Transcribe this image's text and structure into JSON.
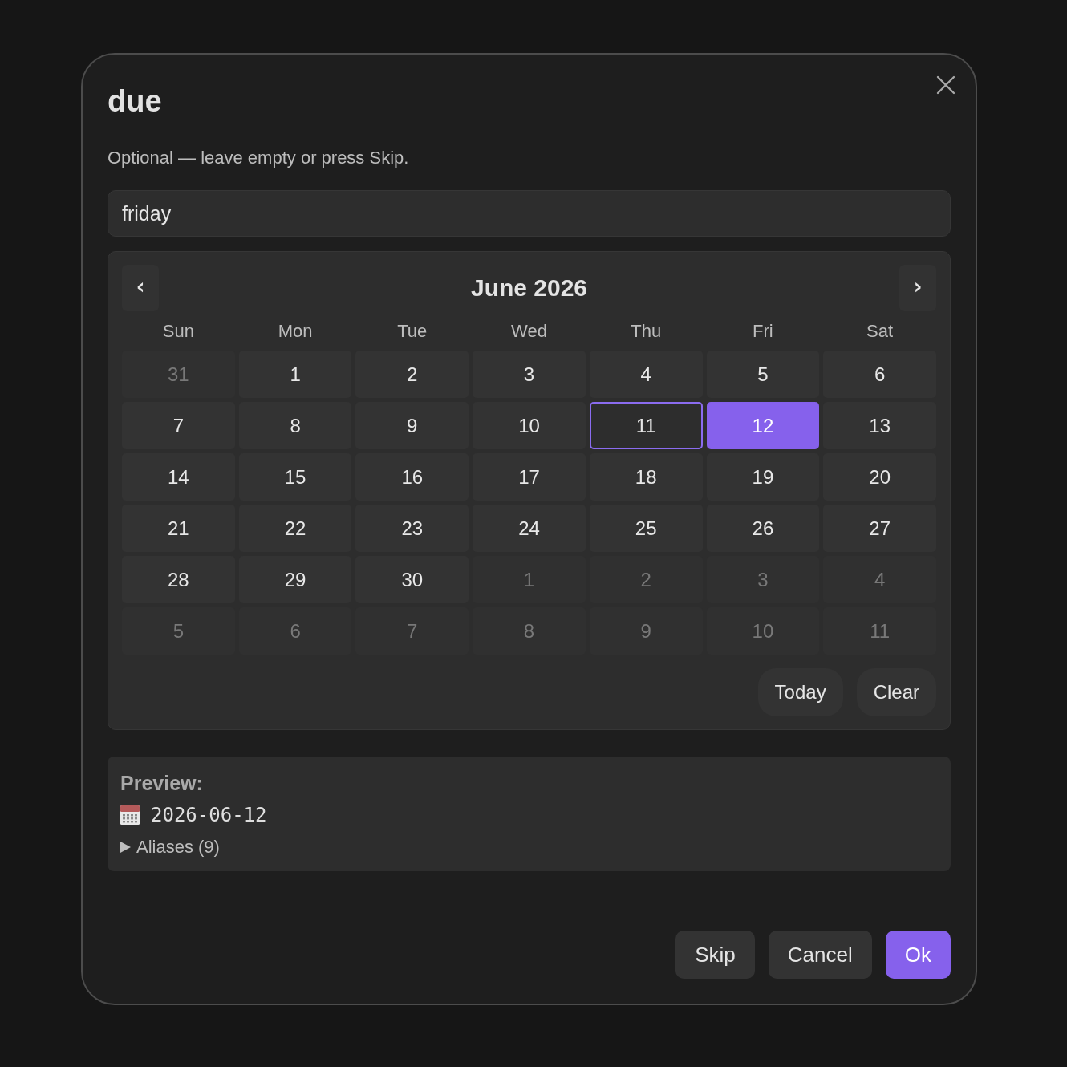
{
  "dialog": {
    "title": "due",
    "description": "Optional — leave empty or press Skip."
  },
  "input": {
    "value": "friday"
  },
  "calendar": {
    "prev": "‹",
    "next": "›",
    "month_label": "June 2026",
    "weekdays": [
      "Sun",
      "Mon",
      "Tue",
      "Wed",
      "Thu",
      "Fri",
      "Sat"
    ],
    "weeks": [
      [
        {
          "label": "31",
          "outside_month": true,
          "today": false,
          "selected": false
        },
        {
          "label": "1",
          "outside_month": false,
          "today": false,
          "selected": false
        },
        {
          "label": "2",
          "outside_month": false,
          "today": false,
          "selected": false
        },
        {
          "label": "3",
          "outside_month": false,
          "today": false,
          "selected": false
        },
        {
          "label": "4",
          "outside_month": false,
          "today": false,
          "selected": false
        },
        {
          "label": "5",
          "outside_month": false,
          "today": false,
          "selected": false
        },
        {
          "label": "6",
          "outside_month": false,
          "today": false,
          "selected": false
        }
      ],
      [
        {
          "label": "7",
          "outside_month": false,
          "today": false,
          "selected": false
        },
        {
          "label": "8",
          "outside_month": false,
          "today": false,
          "selected": false
        },
        {
          "label": "9",
          "outside_month": false,
          "today": false,
          "selected": false
        },
        {
          "label": "10",
          "outside_month": false,
          "today": false,
          "selected": false
        },
        {
          "label": "11",
          "outside_month": false,
          "today": true,
          "selected": false
        },
        {
          "label": "12",
          "outside_month": false,
          "today": false,
          "selected": true
        },
        {
          "label": "13",
          "outside_month": false,
          "today": false,
          "selected": false
        }
      ],
      [
        {
          "label": "14",
          "outside_month": false,
          "today": false,
          "selected": false
        },
        {
          "label": "15",
          "outside_month": false,
          "today": false,
          "selected": false
        },
        {
          "label": "16",
          "outside_month": false,
          "today": false,
          "selected": false
        },
        {
          "label": "17",
          "outside_month": false,
          "today": false,
          "selected": false
        },
        {
          "label": "18",
          "outside_month": false,
          "today": false,
          "selected": false
        },
        {
          "label": "19",
          "outside_month": false,
          "today": false,
          "selected": false
        },
        {
          "label": "20",
          "outside_month": false,
          "today": false,
          "selected": false
        }
      ],
      [
        {
          "label": "21",
          "outside_month": false,
          "today": false,
          "selected": false
        },
        {
          "label": "22",
          "outside_month": false,
          "today": false,
          "selected": false
        },
        {
          "label": "23",
          "outside_month": false,
          "today": false,
          "selected": false
        },
        {
          "label": "24",
          "outside_month": false,
          "today": false,
          "selected": false
        },
        {
          "label": "25",
          "outside_month": false,
          "today": false,
          "selected": false
        },
        {
          "label": "26",
          "outside_month": false,
          "today": false,
          "selected": false
        },
        {
          "label": "27",
          "outside_month": false,
          "today": false,
          "selected": false
        }
      ],
      [
        {
          "label": "28",
          "outside_month": false,
          "today": false,
          "selected": false
        },
        {
          "label": "29",
          "outside_month": false,
          "today": false,
          "selected": false
        },
        {
          "label": "30",
          "outside_month": false,
          "today": false,
          "selected": false
        },
        {
          "label": "1",
          "outside_month": true,
          "today": false,
          "selected": false
        },
        {
          "label": "2",
          "outside_month": true,
          "today": false,
          "selected": false
        },
        {
          "label": "3",
          "outside_month": true,
          "today": false,
          "selected": false
        },
        {
          "label": "4",
          "outside_month": true,
          "today": false,
          "selected": false
        }
      ],
      [
        {
          "label": "5",
          "outside_month": true,
          "today": false,
          "selected": false
        },
        {
          "label": "6",
          "outside_month": true,
          "today": false,
          "selected": false
        },
        {
          "label": "7",
          "outside_month": true,
          "today": false,
          "selected": false
        },
        {
          "label": "8",
          "outside_month": true,
          "today": false,
          "selected": false
        },
        {
          "label": "9",
          "outside_month": true,
          "today": false,
          "selected": false
        },
        {
          "label": "10",
          "outside_month": true,
          "today": false,
          "selected": false
        },
        {
          "label": "11",
          "outside_month": true,
          "today": false,
          "selected": false
        }
      ]
    ],
    "actions": [
      "Today",
      "Clear"
    ]
  },
  "preview": {
    "label": "Preview:",
    "date": "2026-06-12",
    "aliases": {
      "label": "Aliases (9)",
      "expanded": false
    }
  },
  "buttons": [
    {
      "label": "Skip",
      "kind": "secondary"
    },
    {
      "label": "Cancel",
      "kind": "secondary"
    },
    {
      "label": "Ok",
      "kind": "primary"
    }
  ]
}
